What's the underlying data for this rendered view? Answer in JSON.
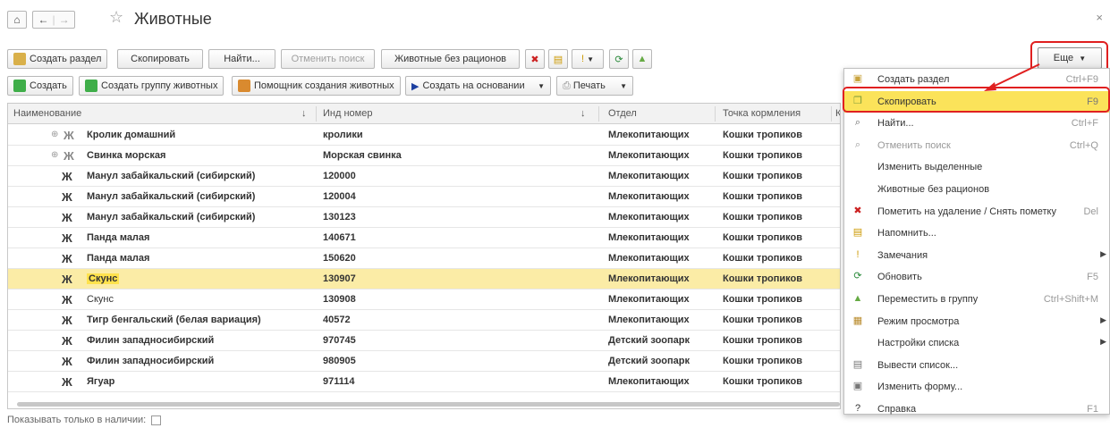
{
  "window": {
    "title": "Животные",
    "home_icon": "home-icon",
    "back_icon": "back-arrow-icon",
    "forward_icon": "forward-arrow-icon",
    "star_icon": "star-icon",
    "close_icon": "close-icon",
    "close_symbol": "×"
  },
  "toolbar1": {
    "create_section": "Создать раздел",
    "copy": "Скопировать",
    "find": "Найти...",
    "cancel_search": "Отменить поиск",
    "no_rations": "Животные без рационов",
    "more": "Еще"
  },
  "toolbar2": {
    "create": "Создать",
    "create_group": "Создать группу животных",
    "wizard": "Помощник создания животных",
    "create_based": "Создать на основании",
    "print": "Печать"
  },
  "table": {
    "columns": [
      "Наименование",
      "Инд номер",
      "Отдел",
      "Точка кормления",
      "К"
    ],
    "rows": [
      {
        "name": "Кролик домашний",
        "id": "кролики",
        "dept": "Млекопитающих",
        "feed": "Кошки тропиков",
        "group": true
      },
      {
        "name": "Свинка морская",
        "id": "Морская свинка",
        "dept": "Млекопитающих",
        "feed": "Кошки тропиков",
        "group": true
      },
      {
        "name": "Манул забайкальский (сибирский)",
        "id": "120000",
        "dept": "Млекопитающих",
        "feed": "Кошки тропиков"
      },
      {
        "name": "Манул забайкальский (сибирский)",
        "id": "120004",
        "dept": "Млекопитающих",
        "feed": "Кошки тропиков"
      },
      {
        "name": "Манул забайкальский (сибирский)",
        "id": "130123",
        "dept": "Млекопитающих",
        "feed": "Кошки тропиков"
      },
      {
        "name": "Панда малая",
        "id": "140671",
        "dept": "Млекопитающих",
        "feed": "Кошки тропиков"
      },
      {
        "name": "Панда малая",
        "id": "150620",
        "dept": "Млекопитающих",
        "feed": "Кошки тропиков"
      },
      {
        "name": "Скунс",
        "id": "130907",
        "dept": "Млекопитающих",
        "feed": "Кошки тропиков",
        "selected": true
      },
      {
        "name": "Скунс",
        "id": "130908",
        "dept": "Млекопитающих",
        "feed": "Кошки тропиков"
      },
      {
        "name": "Тигр бенгальский (белая вариация)",
        "id": "40572",
        "dept": "Млекопитающих",
        "feed": "Кошки тропиков"
      },
      {
        "name": "Филин западносибирский",
        "id": "970745",
        "dept": "Детский зоопарк",
        "feed": "Кошки тропиков"
      },
      {
        "name": "Филин западносибирский",
        "id": "980905",
        "dept": "Детский зоопарк",
        "feed": "Кошки тропиков"
      },
      {
        "name": "Ягуар",
        "id": "971114",
        "dept": "Млекопитающих",
        "feed": "Кошки тропиков"
      }
    ]
  },
  "footer": {
    "only_available": "Показывать только в наличии:"
  },
  "menu": {
    "items": [
      {
        "label": "Создать раздел",
        "key": "Ctrl+F9",
        "icon": "folder-plus-icon"
      },
      {
        "label": "Скопировать",
        "key": "F9",
        "icon": "copy-icon",
        "highlighted": true
      },
      {
        "label": "Найти...",
        "key": "Ctrl+F",
        "icon": "search-icon"
      },
      {
        "label": "Отменить поиск",
        "key": "Ctrl+Q",
        "icon": "cancel-search-icon",
        "disabled": true
      },
      {
        "label": "Изменить выделенные",
        "key": ""
      },
      {
        "label": "Животные без рационов",
        "key": ""
      },
      {
        "label": "Пометить на удаление / Снять пометку",
        "key": "Del",
        "icon": "delete-mark-icon"
      },
      {
        "label": "Напомнить...",
        "key": "",
        "icon": "reminder-icon"
      },
      {
        "label": "Замечания",
        "key": "",
        "icon": "exclamation-icon",
        "submenu": true
      },
      {
        "label": "Обновить",
        "key": "F5",
        "icon": "refresh-icon"
      },
      {
        "label": "Переместить в группу",
        "key": "Ctrl+Shift+M",
        "icon": "move-group-icon"
      },
      {
        "label": "Режим просмотра",
        "key": "",
        "icon": "view-mode-icon",
        "submenu": true
      },
      {
        "label": "Настройки списка",
        "key": "",
        "submenu": true
      },
      {
        "label": "Вывести список...",
        "key": "",
        "icon": "export-list-icon"
      },
      {
        "label": "Изменить форму...",
        "key": "",
        "icon": "edit-form-icon"
      },
      {
        "label": "Справка",
        "key": "F1",
        "icon": "help-icon"
      }
    ]
  },
  "colors": {
    "accent_highlight": "#fbe35a",
    "callout_red": "#e02020",
    "selected_row": "#fbeca6"
  }
}
